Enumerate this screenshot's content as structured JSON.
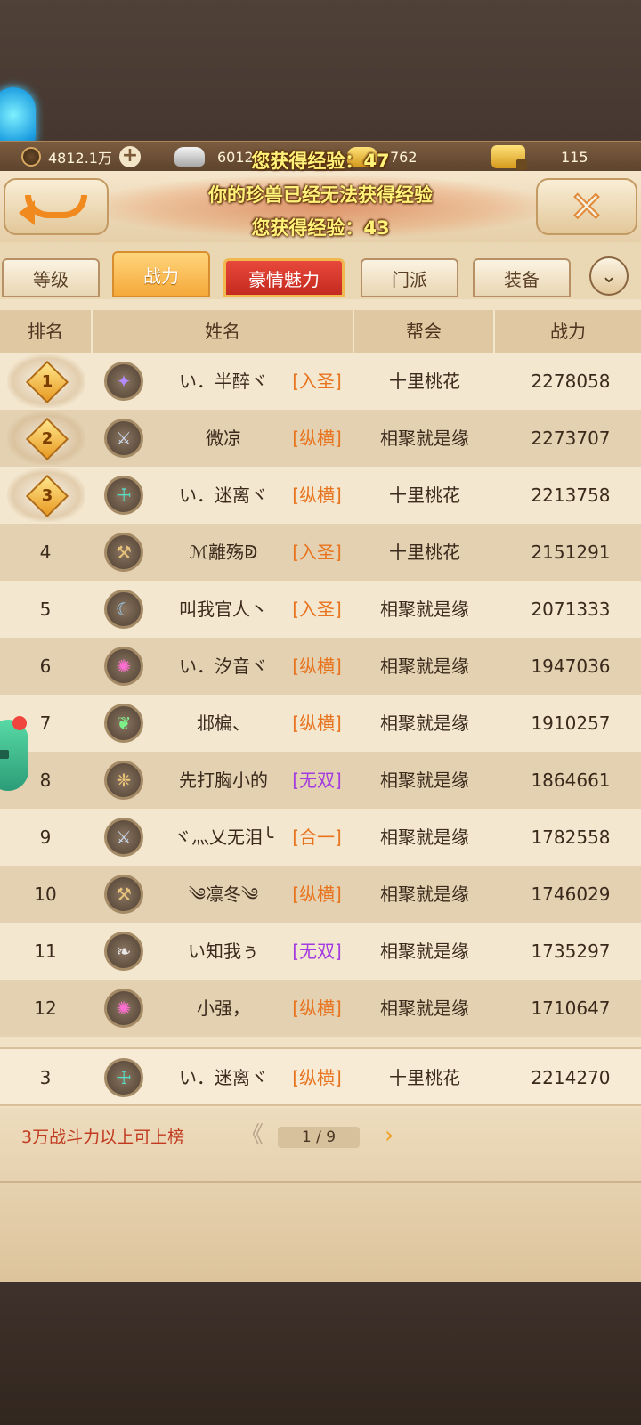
{
  "resources": [
    {
      "icon": "copper-coin-icon",
      "value": "4812.1万"
    },
    {
      "icon": "silver-ingot-icon",
      "value": "60123"
    },
    {
      "icon": "gold-ingot-icon",
      "value": "762"
    },
    {
      "icon": "locked-gold-icon",
      "value": "115"
    }
  ],
  "notifications": {
    "exp_top": "您获得经验：47",
    "pet_msg": "你的珍兽已经无法获得经验",
    "exp_bottom": "您获得经验：43"
  },
  "tabs": [
    "等级",
    "战力",
    "豪情魅力",
    "门派",
    "装备"
  ],
  "active_tab": "战力",
  "columns": {
    "rank": "排名",
    "name": "姓名",
    "guild": "帮会",
    "power": "战力"
  },
  "rows": [
    {
      "rank": "1",
      "name": "い．半醉ヾ",
      "tag": "[入圣]",
      "tag_color": "#e8731e",
      "guild": "十里桃花",
      "power": "2278058",
      "avatar": "purple-emblem-icon",
      "glyph": "✦",
      "avatar_color": "#b48cff"
    },
    {
      "rank": "2",
      "name": "微凉",
      "tag": "[纵横]",
      "tag_color": "#e8731e",
      "guild": "相聚就是缘",
      "power": "2273707",
      "avatar": "double-axe-icon",
      "glyph": "⚔",
      "avatar_color": "#c9d6ea"
    },
    {
      "rank": "3",
      "name": "い．迷离ヾ",
      "tag": "[纵横]",
      "tag_color": "#e8731e",
      "guild": "十里桃花",
      "power": "2213758",
      "avatar": "totem-icon",
      "glyph": "☩",
      "avatar_color": "#55e0c6"
    },
    {
      "rank": "4",
      "name": "ℳ離殇ↁ",
      "tag": "[入圣]",
      "tag_color": "#e8731e",
      "guild": "十里桃花",
      "power": "2151291",
      "avatar": "sword-icon",
      "glyph": "⚒",
      "avatar_color": "#e6c27a"
    },
    {
      "rank": "5",
      "name": "叫我官人丶",
      "tag": "[入圣]",
      "tag_color": "#e8731e",
      "guild": "相聚就是缘",
      "power": "2071333",
      "avatar": "swirl-icon",
      "glyph": "☾",
      "avatar_color": "#9fd8ff"
    },
    {
      "rank": "6",
      "name": "い．汐音ヾ",
      "tag": "[纵横]",
      "tag_color": "#e8731e",
      "guild": "相聚就是缘",
      "power": "1947036",
      "avatar": "pink-ring-icon",
      "glyph": "✺",
      "avatar_color": "#ff6fd3"
    },
    {
      "rank": "7",
      "name": "邶楄、",
      "tag": "[纵横]",
      "tag_color": "#e8731e",
      "guild": "相聚就是缘",
      "power": "1910257",
      "avatar": "green-leaf-icon",
      "glyph": "❦",
      "avatar_color": "#7ef08a"
    },
    {
      "rank": "8",
      "name": "先打胸小的",
      "tag": "[无双]",
      "tag_color": "#a33be0",
      "guild": "相聚就是缘",
      "power": "1864661",
      "avatar": "wings-icon",
      "glyph": "❈",
      "avatar_color": "#f0c878"
    },
    {
      "rank": "9",
      "name": "ヾ灬乂无泪╰",
      "tag": "[合一]",
      "tag_color": "#e8731e",
      "guild": "相聚就是缘",
      "power": "1782558",
      "avatar": "double-axe-icon",
      "glyph": "⚔",
      "avatar_color": "#c9d6ea"
    },
    {
      "rank": "10",
      "name": "༄凛冬༄",
      "tag": "[纵横]",
      "tag_color": "#e8731e",
      "guild": "相聚就是缘",
      "power": "1746029",
      "avatar": "sword-icon",
      "glyph": "⚒",
      "avatar_color": "#e6c27a"
    },
    {
      "rank": "11",
      "name": "い知我ぅ",
      "tag": "[无双]",
      "tag_color": "#a33be0",
      "guild": "相聚就是缘",
      "power": "1735297",
      "avatar": "flame-icon",
      "glyph": "❧",
      "avatar_color": "#e8e8e8"
    },
    {
      "rank": "12",
      "name": "小强，",
      "tag": "[纵横]",
      "tag_color": "#e8731e",
      "guild": "相聚就是缘",
      "power": "1710647",
      "avatar": "pink-ring-icon",
      "glyph": "✺",
      "avatar_color": "#ff6fd3"
    }
  ],
  "self_row": {
    "rank": "3",
    "name": "い．迷离ヾ",
    "tag": "[纵横]",
    "tag_color": "#e8731e",
    "guild": "十里桃花",
    "power": "2214270",
    "avatar": "totem-icon",
    "glyph": "☩",
    "avatar_color": "#55e0c6"
  },
  "footer": {
    "note": "3万战斗力以上可上榜",
    "page": "1 / 9",
    "prev": "《",
    "next": "›"
  }
}
